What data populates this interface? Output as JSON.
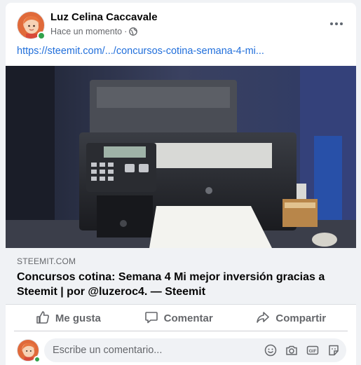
{
  "post": {
    "author": "Luz Celina Caccavale",
    "time": "Hace un momento",
    "separator": "·",
    "link_text": "https://steemit.com/.../concursos-cotina-semana-4-mi..."
  },
  "link_preview": {
    "domain": "STEEMIT.COM",
    "title": "Concursos cotina: Semana 4 Mi mejor inversión gracias a Steemit | por @luzeroc4. — Steemit"
  },
  "actions": {
    "like_label": "Me gusta",
    "comment_label": "Comentar",
    "share_label": "Compartir"
  },
  "comment": {
    "placeholder": "Escribe un comentario..."
  },
  "icons": {
    "privacy": "globe-icon",
    "more": "more-options-icon",
    "like": "thumbs-up-icon",
    "comment": "speech-bubble-icon",
    "share": "share-arrow-icon",
    "emoji": "emoji-icon",
    "camera": "camera-icon",
    "gif": "gif-icon",
    "sticker": "sticker-icon"
  },
  "colors": {
    "link": "#216fdb",
    "online": "#31a24c",
    "secondary_text": "#65676b"
  }
}
